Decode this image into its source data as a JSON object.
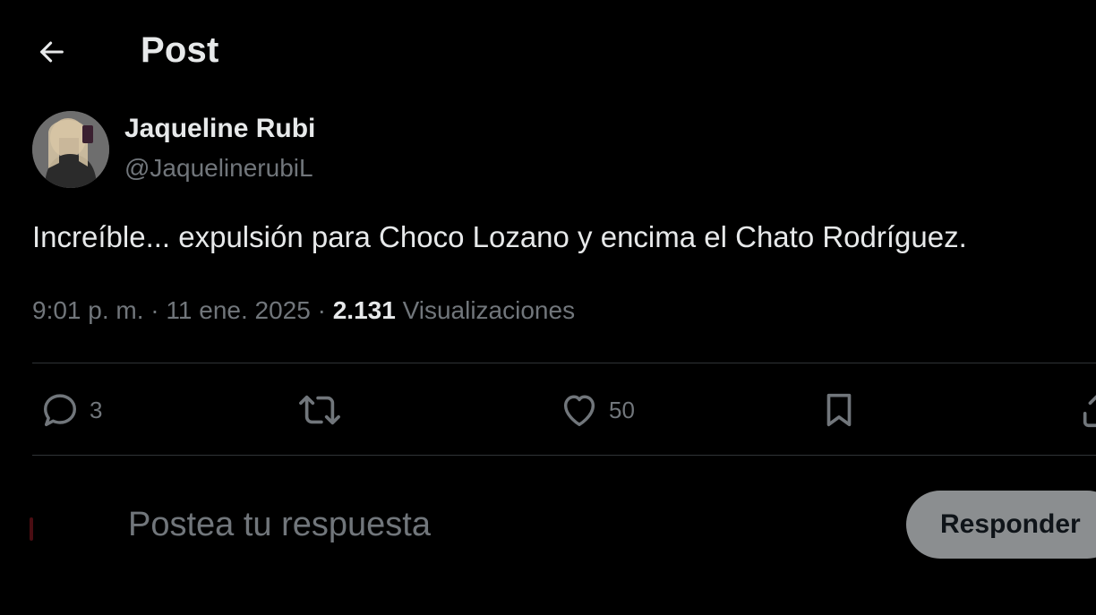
{
  "header": {
    "title": "Post",
    "back_icon": "arrow-left-icon"
  },
  "post": {
    "author": {
      "name": "Jaqueline Rubi",
      "handle": "@JaquelinerubiL"
    },
    "text": "Increíble... expulsión para Choco Lozano y encima el Chato Rodríguez.",
    "meta": {
      "time": "9:01 p. m.",
      "separator": "·",
      "date": "11 ene. 2025",
      "views_count": "2.131",
      "views_label": "Visualizaciones"
    },
    "actions": {
      "replies_count": "3",
      "likes_count": "50",
      "icons": [
        "reply-icon",
        "repost-icon",
        "like-icon",
        "bookmark-icon",
        "share-icon"
      ]
    }
  },
  "reply_composer": {
    "placeholder": "Postea tu respuesta",
    "button_label": "Responder"
  },
  "colors": {
    "background": "#000000",
    "text_primary": "#e7e9ea",
    "text_secondary": "#71767b",
    "divider": "#2f3336",
    "button_disabled": "#8b8e90"
  }
}
